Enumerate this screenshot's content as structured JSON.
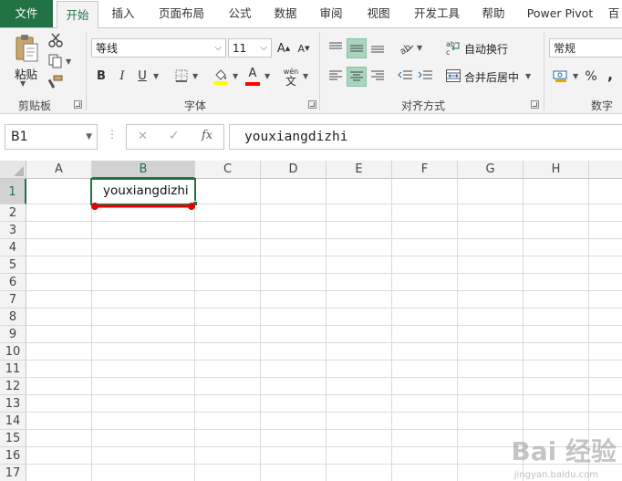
{
  "tabs": [
    {
      "label": "文件"
    },
    {
      "label": "开始"
    },
    {
      "label": "插入"
    },
    {
      "label": "页面布局"
    },
    {
      "label": "公式"
    },
    {
      "label": "数据"
    },
    {
      "label": "审阅"
    },
    {
      "label": "视图"
    },
    {
      "label": "开发工具"
    },
    {
      "label": "帮助"
    },
    {
      "label": "Power Pivot"
    },
    {
      "label": "百"
    }
  ],
  "clipboard": {
    "paste_label": "粘贴",
    "group_label": "剪贴板"
  },
  "font": {
    "name": "等线",
    "size": "11",
    "bold": "B",
    "italic": "I",
    "underline": "U",
    "phonetic": "wén",
    "group_label": "字体",
    "highlight_color": "#FFFF00",
    "font_color": "#FF0000"
  },
  "alignment": {
    "wrap_label": "自动换行",
    "merge_label": "合并后居中",
    "group_label": "对齐方式"
  },
  "number": {
    "format": "常规",
    "percent": "%",
    "comma": ",",
    "group_label": "数字"
  },
  "formula_bar": {
    "name_box": "B1",
    "cancel": "✕",
    "enter": "✓",
    "fx": "fx",
    "content": "youxiangdizhi"
  },
  "columns": [
    "A",
    "B",
    "C",
    "D",
    "E",
    "F",
    "G",
    "H"
  ],
  "rows": [
    "1",
    "2",
    "3",
    "4",
    "5",
    "6",
    "7",
    "8",
    "9",
    "10",
    "11",
    "12",
    "13",
    "14",
    "15",
    "16",
    "17"
  ],
  "cells": {
    "B1": "youxiangdizhi"
  },
  "colors": {
    "accent": "#217346",
    "annotation": "#E60000"
  },
  "watermark": {
    "main": "Bai 经验",
    "sub": "jingyan.baidu.com"
  }
}
